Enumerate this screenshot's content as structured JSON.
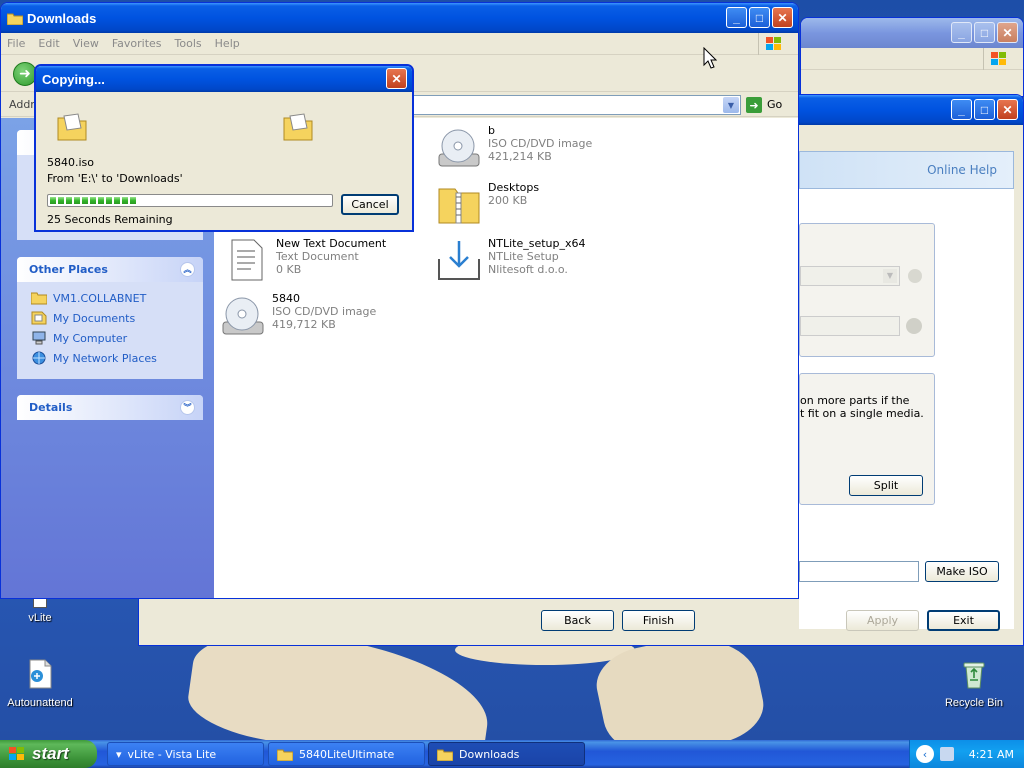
{
  "desktop": {
    "icons": {
      "vlite": "vLite",
      "autounattend": "Autounattend",
      "recycle": "Recycle Bin"
    }
  },
  "vlite_window": {
    "online_help": "Online Help",
    "split_text": "on more parts if the\nt fit on a single media.",
    "split_button": "Split",
    "make_iso_button": "Make ISO",
    "back_button": "Back",
    "finish_button": "Finish",
    "apply_button": "Apply",
    "exit_button": "Exit"
  },
  "explorer": {
    "title": "Downloads",
    "menu": [
      "File",
      "Edit",
      "View",
      "Favorites",
      "Tools",
      "Help"
    ],
    "address_label": "Addre",
    "go_label": "Go",
    "other_places": {
      "title": "Other Places",
      "items": [
        "VM1.COLLABNET",
        "My Documents",
        "My Computer",
        "My Network Places"
      ]
    },
    "details": {
      "title": "Details"
    },
    "files": [
      {
        "name": "b",
        "type": "ISO CD/DVD image",
        "size": "421,214 KB"
      },
      {
        "name": "Desktops",
        "type": "200 KB",
        "size": ""
      },
      {
        "name": "New Text Document",
        "type": "Text Document",
        "size": "0 KB"
      },
      {
        "name": "NTLite_setup_x64",
        "type": "NTLite Setup",
        "size": "Nlitesoft d.o.o."
      },
      {
        "name": "5840",
        "type": "ISO CD/DVD image",
        "size": "419,712 KB"
      }
    ]
  },
  "copy_dialog": {
    "title": "Copying...",
    "filename": "5840.iso",
    "from_to": "From 'E:\\' to 'Downloads'",
    "remaining": "25 Seconds Remaining",
    "cancel_button": "Cancel",
    "progress": 0.3
  },
  "taskbar": {
    "start": "start",
    "buttons": [
      "vLite - Vista Lite",
      "5840LiteUltimate",
      "Downloads"
    ],
    "clock": "4:21 AM"
  }
}
